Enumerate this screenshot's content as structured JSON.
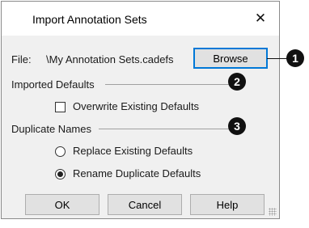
{
  "dialog": {
    "title": "Import Annotation Sets",
    "close_glyph": "✕"
  },
  "file": {
    "label": "File:",
    "value": "\\My Annotation Sets.cadefs",
    "browse_label": "Browse"
  },
  "imported_defaults": {
    "label": "Imported Defaults",
    "overwrite_label": "Overwrite Existing Defaults",
    "overwrite_checked": false
  },
  "duplicate_names": {
    "label": "Duplicate Names",
    "options": [
      {
        "label": "Replace Existing Defaults",
        "selected": false
      },
      {
        "label": "Rename Duplicate Defaults",
        "selected": true
      }
    ]
  },
  "buttons": {
    "ok": "OK",
    "cancel": "Cancel",
    "help": "Help"
  },
  "callouts": [
    "1",
    "2",
    "3"
  ],
  "colors": {
    "dialog_bg": "#f0f0f0",
    "default_button_border": "#0078d7",
    "callout_bg": "#111111"
  }
}
